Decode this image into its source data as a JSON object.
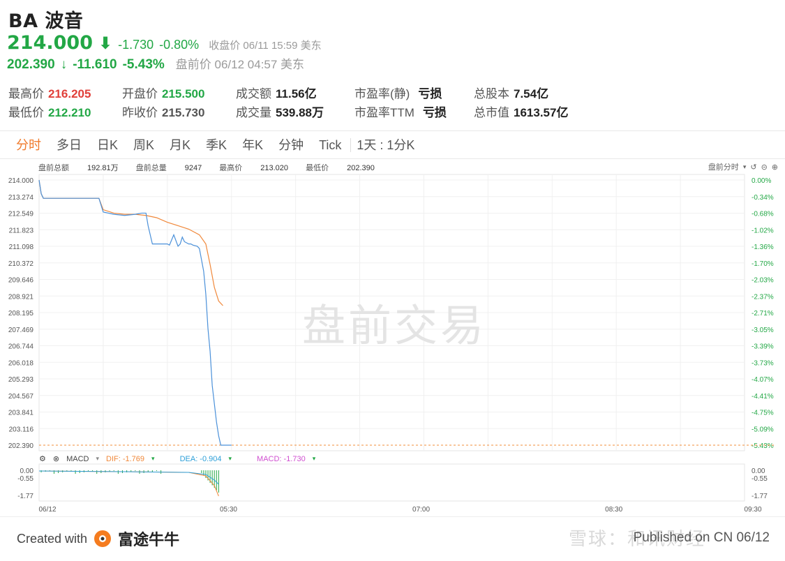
{
  "header": {
    "title": "BA 波音",
    "price": "214.000",
    "change": "-1.730",
    "change_pct": "-0.80%",
    "close_meta": "收盘价 06/11 15:59 美东",
    "pre_price": "202.390",
    "pre_arrow": "↓",
    "pre_change": "-11.610",
    "pre_change_pct": "-5.43%",
    "pre_meta": "盘前价 06/12 04:57 美东"
  },
  "stats": {
    "high_label": "最高价",
    "high": "216.205",
    "low_label": "最低价",
    "low": "212.210",
    "open_label": "开盘价",
    "open": "215.500",
    "prev_label": "昨收价",
    "prev": "215.730",
    "amount_label": "成交额",
    "amount": "11.56亿",
    "volume_label": "成交量",
    "volume": "539.88万",
    "pe_static_label": "市盈率(静)",
    "pe_static": "亏损",
    "pe_ttm_label": "市盈率TTM",
    "pe_ttm": "亏损",
    "shares_label": "总股本",
    "shares": "7.54亿",
    "mcap_label": "总市值",
    "mcap": "1613.57亿"
  },
  "tabs": [
    "分时",
    "多日",
    "日K",
    "周K",
    "月K",
    "季K",
    "年K",
    "分钟",
    "Tick"
  ],
  "tab_extra": "1天 : 1分K",
  "chart_info": {
    "amount_label": "盘前总额",
    "amount": "192.81万",
    "volume_label": "盘前总量",
    "volume": "9247",
    "high_label": "最高价",
    "high": "213.020",
    "low_label": "最低价",
    "low": "202.390",
    "mode": "盘前分时",
    "watermark": "盘前交易"
  },
  "macd": {
    "label": "MACD",
    "dif": "DIF: -1.769",
    "dea": "DEA: -0.904",
    "macd": "MACD: -1.730"
  },
  "footer": {
    "created_with": "Created with",
    "brand": "富途牛牛",
    "published": "Published on CN 06/12",
    "xq": "雪球：和讯财经"
  },
  "colors": {
    "up": "#e0403a",
    "down": "#22a745",
    "accent": "#f07a2b",
    "price_line": "#4a90d9",
    "avg_line": "#f0883a"
  },
  "chart_data": {
    "type": "line",
    "title": "",
    "y_ticks": [
      "214.000",
      "213.274",
      "212.549",
      "211.823",
      "211.098",
      "210.372",
      "209.646",
      "208.921",
      "208.195",
      "207.469",
      "206.744",
      "206.018",
      "205.293",
      "204.567",
      "203.841",
      "203.116",
      "202.390"
    ],
    "y_pct_ticks": [
      "0.00%",
      "-0.34%",
      "-0.68%",
      "-1.02%",
      "-1.36%",
      "-1.70%",
      "-2.03%",
      "-2.37%",
      "-2.71%",
      "-3.05%",
      "-3.39%",
      "-3.73%",
      "-4.07%",
      "-4.41%",
      "-4.75%",
      "-5.09%",
      "-5.43%"
    ],
    "x_ticks": [
      "06/12",
      "05:30",
      "07:00",
      "08:30",
      "09:30"
    ],
    "ylim": [
      202.39,
      214.0
    ],
    "x_range_minutes": [
      240,
      570
    ],
    "price_series": {
      "name": "",
      "x": [
        240,
        241,
        242,
        250,
        260,
        268,
        270,
        275,
        280,
        285,
        288,
        290,
        291,
        293,
        295,
        298,
        300,
        301,
        303,
        305,
        306,
        307,
        308,
        309,
        310,
        311,
        312,
        314,
        315,
        316,
        317,
        318,
        319,
        320,
        321,
        322,
        323,
        324,
        325,
        326,
        327,
        328,
        329,
        330
      ],
      "values": [
        214.0,
        213.4,
        213.2,
        213.2,
        213.2,
        213.2,
        212.6,
        212.5,
        212.45,
        212.5,
        212.55,
        212.55,
        212.0,
        211.2,
        211.2,
        211.2,
        211.2,
        211.15,
        211.6,
        211.1,
        211.2,
        211.5,
        211.3,
        211.25,
        211.2,
        211.2,
        211.15,
        211.1,
        211.0,
        210.5,
        210.0,
        209.0,
        207.5,
        206.5,
        205.0,
        204.2,
        203.4,
        202.8,
        202.39,
        202.39,
        202.39,
        202.39,
        202.39,
        202.39
      ]
    },
    "avg_series": {
      "name": "",
      "x": [
        240,
        241,
        242,
        250,
        260,
        268,
        270,
        275,
        280,
        285,
        290,
        295,
        300,
        305,
        310,
        315,
        318,
        320,
        322,
        324,
        326
      ],
      "values": [
        214.0,
        213.4,
        213.2,
        213.2,
        213.2,
        213.2,
        212.7,
        212.55,
        212.5,
        212.5,
        212.45,
        212.35,
        212.15,
        212.0,
        211.85,
        211.6,
        211.2,
        210.3,
        209.3,
        208.7,
        208.5
      ]
    },
    "macd": {
      "y_ticks": [
        "0.00",
        "-0.55",
        "-1.77"
      ],
      "dif_last": -1.769,
      "dea_last": -0.904,
      "macd_last": -1.73
    },
    "grid": true
  }
}
